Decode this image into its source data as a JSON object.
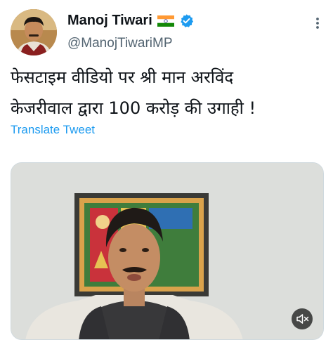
{
  "author": {
    "name": "Manoj Tiwari",
    "handle": "@ManojTiwariMP",
    "flag_icon": "india-flag-icon",
    "verified_icon": "verified-badge-icon"
  },
  "tweet": {
    "line1": "फेसटाइम वीडियो पर श्री मान अरविंद",
    "line2": "केजरीवाल द्वारा 100 करोड़ की उगाही !"
  },
  "translate_label": "Translate Tweet",
  "media": {
    "type": "video",
    "mute_icon": "speaker-muted-icon"
  },
  "colors": {
    "accent": "#1d9bf0",
    "verified": "#1d9bf0",
    "secondary_text": "#536471"
  }
}
